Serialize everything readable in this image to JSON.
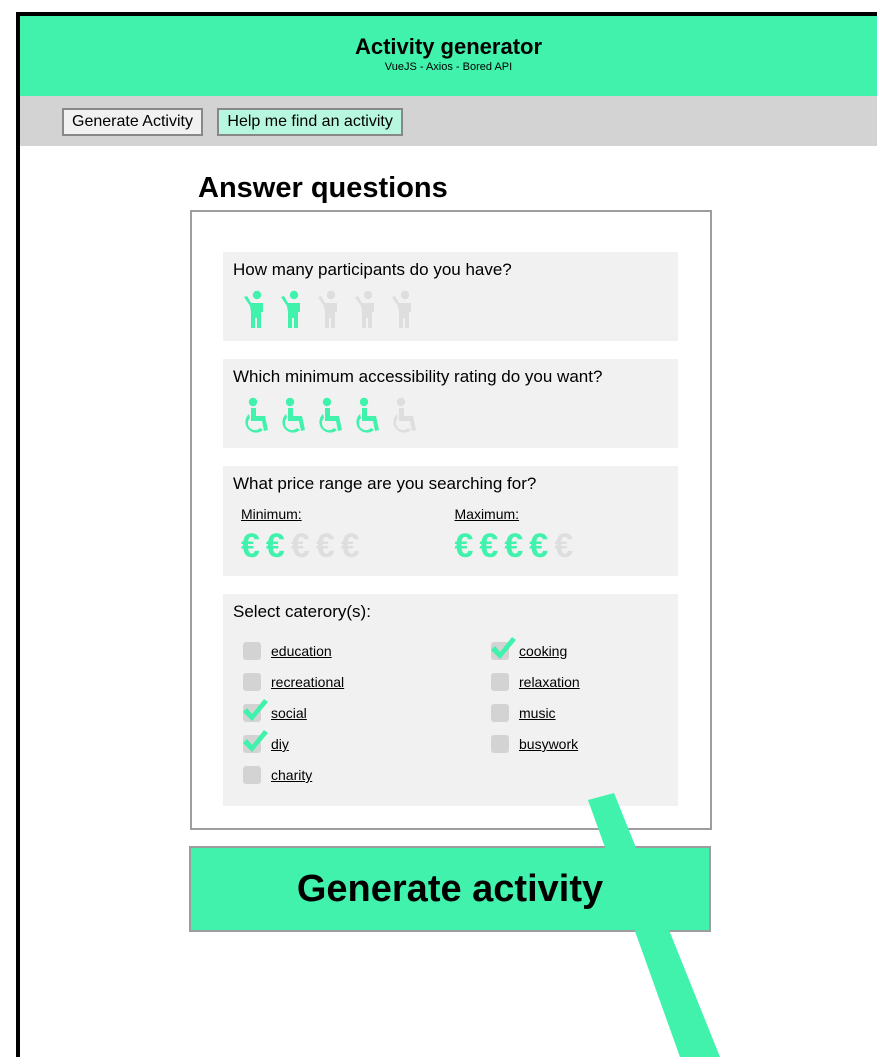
{
  "header": {
    "title": "Activity generator",
    "subtitle": "VueJS - Axios - Bored API"
  },
  "nav": {
    "generate_label": "Generate Activity",
    "help_label": "Help me find an activity"
  },
  "section_title": "Answer questions",
  "questions": {
    "participants": {
      "label": "How many participants do you have?",
      "selected": 2,
      "max": 5
    },
    "accessibility": {
      "label": "Which minimum accessibility rating do you want?",
      "selected": 4,
      "max": 5
    },
    "price": {
      "label": "What price range are you searching for?",
      "min_label": "Minimum:",
      "max_label": "Maximum:",
      "symbol": "€",
      "min_selected": 2,
      "max_selected": 4,
      "max": 5
    },
    "categories": {
      "label": "Select caterory(s):",
      "items": [
        {
          "label": "education",
          "checked": false
        },
        {
          "label": "recreational",
          "checked": false
        },
        {
          "label": "social",
          "checked": true
        },
        {
          "label": "diy",
          "checked": true
        },
        {
          "label": "charity",
          "checked": false
        },
        {
          "label": "cooking",
          "checked": true
        },
        {
          "label": "relaxation",
          "checked": false
        },
        {
          "label": "music",
          "checked": false
        },
        {
          "label": "busywork",
          "checked": false
        }
      ]
    }
  },
  "generate_button": "Generate activity",
  "colors": {
    "accent": "#40f2ac",
    "inactive_icon": "#dedede",
    "panel_bg": "#f1f1f1",
    "nav_bg": "#d3d3d3"
  }
}
